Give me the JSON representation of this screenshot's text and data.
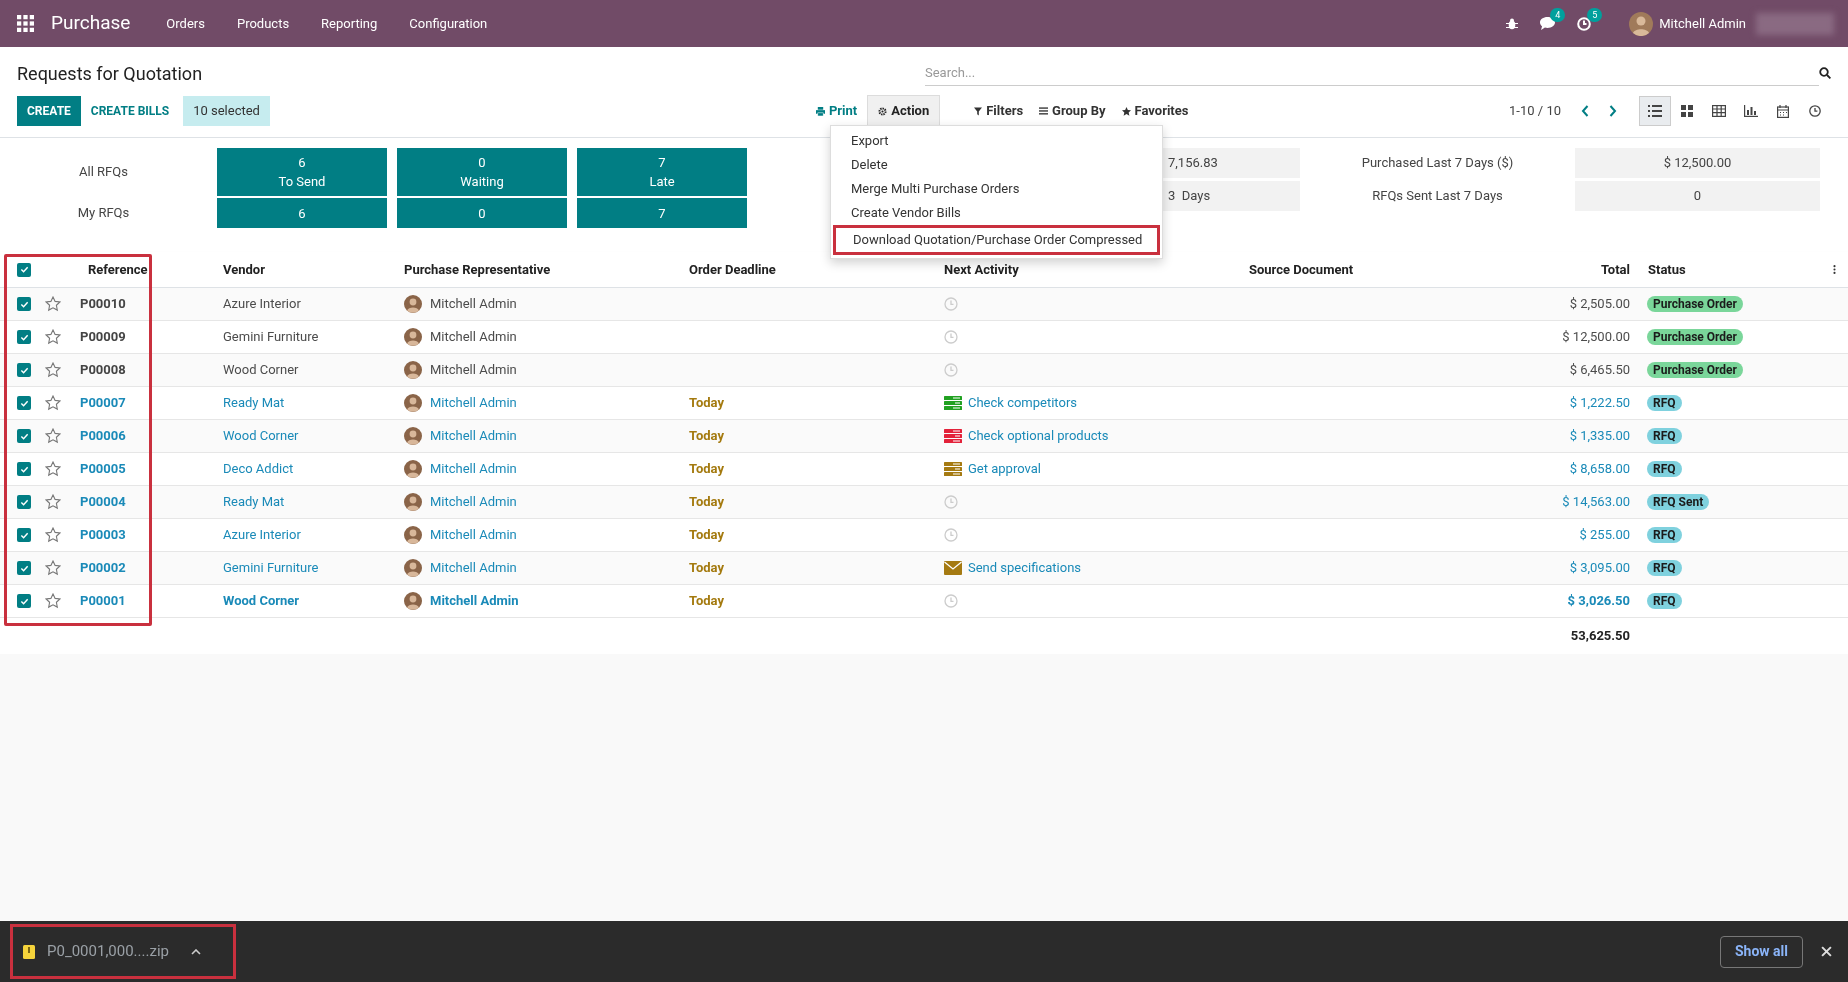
{
  "navbar": {
    "app_name": "Purchase",
    "menus": [
      "Orders",
      "Products",
      "Reporting",
      "Configuration"
    ],
    "messages_count": "4",
    "activities_count": "5",
    "user": "Mitchell Admin"
  },
  "control_panel": {
    "title": "Requests for Quotation",
    "search_placeholder": "Search...",
    "buttons": [
      {
        "label": "CREATE",
        "kind": "primary"
      },
      {
        "label": "CREATE BILLS",
        "kind": "link"
      }
    ],
    "selection": "10 selected",
    "print": "Print",
    "action": {
      "label": "Action",
      "open": true
    },
    "filters": [
      "Filters",
      "Group By",
      "Favorites"
    ],
    "pager": "1-10 / 10",
    "views": [
      {
        "kind": "list",
        "selected": true
      },
      {
        "kind": "kanban",
        "selected": false
      },
      {
        "kind": "pivot",
        "selected": false
      },
      {
        "kind": "graph",
        "selected": false
      },
      {
        "kind": "calendar",
        "selected": false
      },
      {
        "kind": "activity",
        "selected": false
      }
    ]
  },
  "action_menu": [
    {
      "label": "Export",
      "annotated": false
    },
    {
      "label": "Delete",
      "annotated": false
    },
    {
      "label": "Merge Multi Purchase Orders",
      "annotated": false
    },
    {
      "label": "Create Vendor Bills",
      "annotated": false
    },
    {
      "label": "Download Quotation/Purchase Order Compressed",
      "annotated": true
    }
  ],
  "dashboard": {
    "rows": [
      {
        "label": "All RFQs",
        "tiles": [
          {
            "count": "6",
            "caption": "To Send"
          },
          {
            "count": "0",
            "caption": "Waiting"
          },
          {
            "count": "7",
            "caption": "Late"
          }
        ]
      },
      {
        "label": "My RFQs",
        "tiles": [
          {
            "count": "6"
          },
          {
            "count": "0"
          },
          {
            "count": "7"
          }
        ]
      }
    ],
    "stats": [
      {
        "middle_value": "7,156.83",
        "label": "Purchased Last 7 Days ($)",
        "value": "$ 12,500.00"
      },
      {
        "middle_value": "3  Days",
        "label": "RFQs Sent Last 7 Days",
        "value": "0"
      }
    ]
  },
  "table": {
    "annotated": true,
    "all_selected": true,
    "columns": [
      "Reference",
      "Vendor",
      "Purchase Representative",
      "Order Deadline",
      "Next Activity",
      "Source Document",
      "Total",
      "Status"
    ],
    "rows": [
      {
        "selected": true,
        "starred": false,
        "kind": "order",
        "bold": false,
        "reference": "P00010",
        "vendor": "Azure Interior",
        "representative": "Mitchell Admin",
        "activity": {
          "kind": "none"
        },
        "total": "$ 2,505.00",
        "status": "Purchase Order"
      },
      {
        "selected": true,
        "starred": false,
        "kind": "order",
        "bold": false,
        "reference": "P00009",
        "vendor": "Gemini Furniture",
        "representative": "Mitchell Admin",
        "activity": {
          "kind": "none"
        },
        "total": "$ 12,500.00",
        "status": "Purchase Order"
      },
      {
        "selected": true,
        "starred": false,
        "kind": "order",
        "bold": false,
        "reference": "P00008",
        "vendor": "Wood Corner",
        "representative": "Mitchell Admin",
        "activity": {
          "kind": "none"
        },
        "total": "$ 6,465.50",
        "status": "Purchase Order"
      },
      {
        "selected": true,
        "starred": false,
        "kind": "rfq",
        "bold": false,
        "reference": "P00007",
        "vendor": "Ready Mat",
        "representative": "Mitchell Admin",
        "deadline": "Today",
        "activity": {
          "kind": "todo",
          "color": "#21a121",
          "label": "Check competitors"
        },
        "total": "$ 1,222.50",
        "status": "RFQ"
      },
      {
        "selected": true,
        "starred": false,
        "kind": "rfq",
        "bold": false,
        "reference": "P00006",
        "vendor": "Wood Corner",
        "representative": "Mitchell Admin",
        "deadline": "Today",
        "activity": {
          "kind": "todo",
          "color": "#e3223a",
          "label": "Check optional products"
        },
        "total": "$ 1,335.00",
        "status": "RFQ"
      },
      {
        "selected": true,
        "starred": false,
        "kind": "rfq",
        "bold": false,
        "reference": "P00005",
        "vendor": "Deco Addict",
        "representative": "Mitchell Admin",
        "deadline": "Today",
        "activity": {
          "kind": "todo",
          "color": "#a57a12",
          "label": "Get approval"
        },
        "total": "$ 8,658.00",
        "status": "RFQ"
      },
      {
        "selected": true,
        "starred": false,
        "kind": "rfq",
        "bold": false,
        "reference": "P00004",
        "vendor": "Ready Mat",
        "representative": "Mitchell Admin",
        "deadline": "Today",
        "activity": {
          "kind": "none"
        },
        "total": "$ 14,563.00",
        "status": "RFQ Sent"
      },
      {
        "selected": true,
        "starred": false,
        "kind": "rfq",
        "bold": false,
        "reference": "P00003",
        "vendor": "Azure Interior",
        "representative": "Mitchell Admin",
        "deadline": "Today",
        "activity": {
          "kind": "none"
        },
        "total": "$ 255.00",
        "status": "RFQ"
      },
      {
        "selected": true,
        "starred": false,
        "kind": "rfq",
        "bold": false,
        "reference": "P00002",
        "vendor": "Gemini Furniture",
        "representative": "Mitchell Admin",
        "deadline": "Today",
        "activity": {
          "kind": "email",
          "color": "#a57a12",
          "label": "Send specifications"
        },
        "total": "$ 3,095.00",
        "status": "RFQ"
      },
      {
        "selected": true,
        "starred": false,
        "kind": "rfq",
        "bold": true,
        "reference": "P00001",
        "vendor": "Wood Corner",
        "representative": "Mitchell Admin",
        "deadline": "Today",
        "activity": {
          "kind": "none"
        },
        "total": "$ 3,026.50",
        "status": "RFQ"
      }
    ],
    "sum": "53,625.50"
  },
  "download_bar": {
    "file": "P0_0001,000....zip",
    "annotated": true,
    "show_all": "Show all"
  }
}
